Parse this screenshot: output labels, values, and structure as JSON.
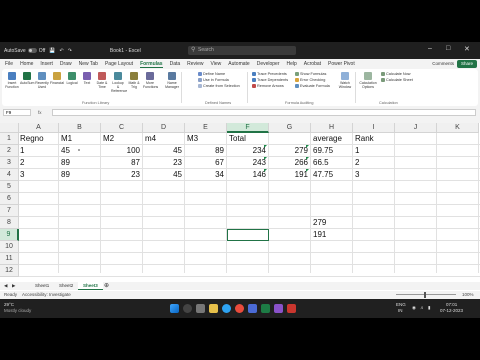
{
  "titlebar": {
    "autosave": "AutoSave",
    "toggle_state": "Off",
    "filename": "Book1 - Excel",
    "search_placeholder": "Search"
  },
  "menu": {
    "tabs": [
      "File",
      "Home",
      "Insert",
      "Draw",
      "New Tab",
      "Page Layout",
      "Formulas",
      "Data",
      "Review",
      "View",
      "Automate",
      "Developer",
      "Help",
      "Acrobat",
      "Power Pivot"
    ],
    "active": "Formulas",
    "comments": "Comments",
    "share": "Share"
  },
  "ribbon": {
    "big_buttons": [
      "Insert Function",
      "AutoSum",
      "Recently Used",
      "Financial",
      "Logical",
      "Text",
      "Date & Time",
      "Lookup & Reference",
      "Math & Trig",
      "More Functions",
      "Name Manager"
    ],
    "function_library_label": "Function Library",
    "defined_names": [
      "Define Name",
      "Use in Formula",
      "Create from Selection"
    ],
    "defined_names_label": "Defined Names",
    "auditing": [
      "Trace Precedents",
      "Trace Dependents",
      "Remove Arrows",
      "Show Formulas",
      "Error Checking",
      "Evaluate Formula"
    ],
    "auditing_label": "Formula Auditing",
    "watch": "Watch Window",
    "calc_options": "Calculation Options",
    "calc_now": "Calculate Now",
    "calc_sheet": "Calculate Sheet",
    "calc_label": "Calculation"
  },
  "formula_bar": {
    "name_box": "F9",
    "fx": "fx",
    "value": ""
  },
  "grid": {
    "columns": [
      "A",
      "B",
      "C",
      "D",
      "E",
      "F",
      "G",
      "H",
      "I",
      "J",
      "K"
    ],
    "rows": [
      "1",
      "2",
      "3",
      "4",
      "5",
      "6",
      "7",
      "8",
      "9",
      "10",
      "11",
      "12"
    ],
    "selected_col": "F",
    "selected_row": "9",
    "headers": {
      "A": "Regno",
      "B": "M1",
      "C": "M2",
      "D": "m4",
      "E": "M3",
      "F": "Total",
      "H": "average",
      "I": "Rank"
    },
    "data": [
      {
        "A": "1",
        "B": "45",
        "C": "100",
        "D": "45",
        "E": "89",
        "F": "234",
        "G": "279",
        "H": "69.75",
        "I": "1"
      },
      {
        "A": "2",
        "B": "89",
        "C": "87",
        "D": "23",
        "E": "67",
        "F": "243",
        "G": "266",
        "H": "66.5",
        "I": "2"
      },
      {
        "A": "3",
        "B": "89",
        "C": "23",
        "D": "45",
        "E": "34",
        "F": "146",
        "G": "191",
        "H": "47.75",
        "I": "3"
      }
    ],
    "h8": "279",
    "h9": "191"
  },
  "sheets": [
    "Sheet1",
    "Sheet2",
    "Sheet3"
  ],
  "active_sheet": "Sheet3",
  "status": {
    "ready": "Ready",
    "accessibility": "Accessibility: Investigate",
    "zoom": "100%"
  },
  "taskbar": {
    "weather_temp": "29°C",
    "weather_desc": "Mostly cloudy",
    "lang": "ENG",
    "region": "IN",
    "time": "07:01",
    "date": "07-12-2023"
  },
  "colors": {
    "accent": "#217346",
    "comment_triangle": "#1e8a4a"
  }
}
